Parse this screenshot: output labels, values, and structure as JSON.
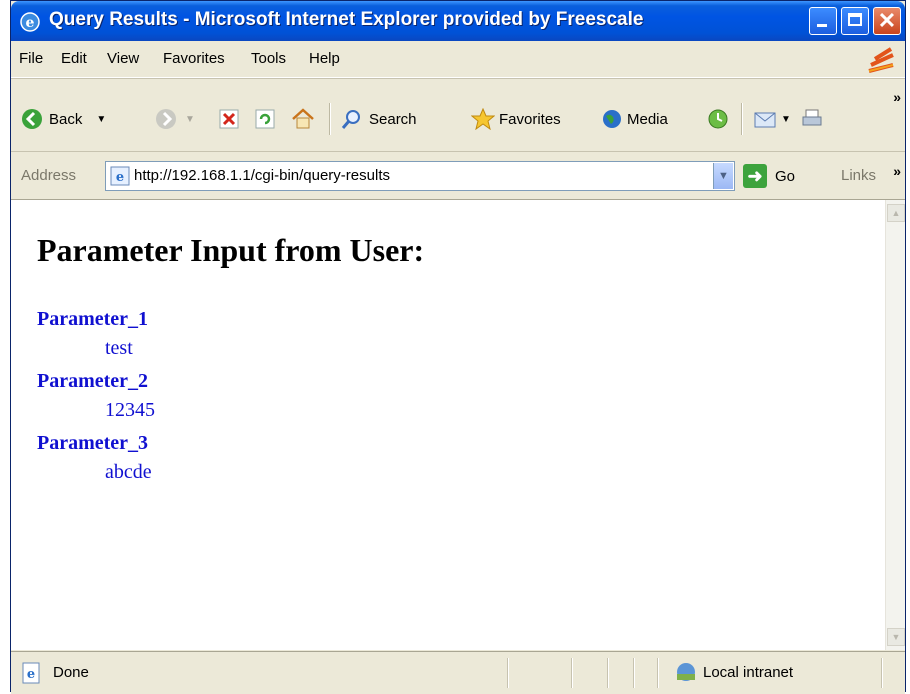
{
  "window": {
    "title": "Query Results - Microsoft Internet Explorer provided by Freescale"
  },
  "menu": {
    "items": [
      "File",
      "Edit",
      "View",
      "Favorites",
      "Tools",
      "Help"
    ]
  },
  "toolbar": {
    "back_label": "Back",
    "search_label": "Search",
    "favorites_label": "Favorites",
    "media_label": "Media"
  },
  "address": {
    "label": "Address",
    "url": "http://192.168.1.1/cgi-bin/query-results",
    "go_label": "Go",
    "links_label": "Links"
  },
  "page": {
    "heading": "Parameter Input from User:",
    "parameters": [
      {
        "name": "Parameter_1",
        "value": "test"
      },
      {
        "name": "Parameter_2",
        "value": "12345"
      },
      {
        "name": "Parameter_3",
        "value": "abcde"
      }
    ]
  },
  "status": {
    "text": "Done",
    "zone": "Local intranet"
  },
  "colors": {
    "titlebar": "#0054e3",
    "link_blue": "#1010d0",
    "chrome": "#ece9d8"
  }
}
